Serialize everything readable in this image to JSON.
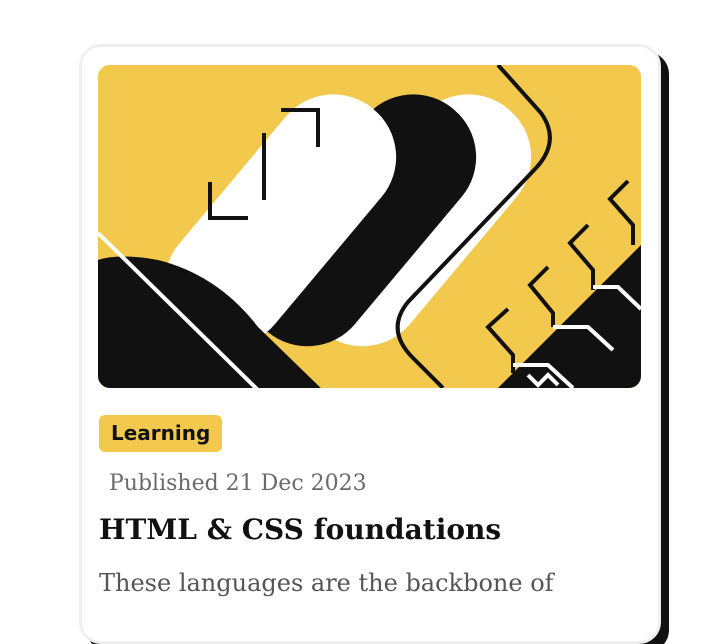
{
  "card": {
    "tag": "Learning",
    "published": "Published 21 Dec 2023",
    "title": "HTML & CSS foundations",
    "description": "These languages are the backbone of"
  },
  "colors": {
    "accent": "#f2c94c",
    "ink": "#111111",
    "muted": "#6a6a6a"
  },
  "hero": {
    "illustration": "abstract-geometric-art"
  }
}
